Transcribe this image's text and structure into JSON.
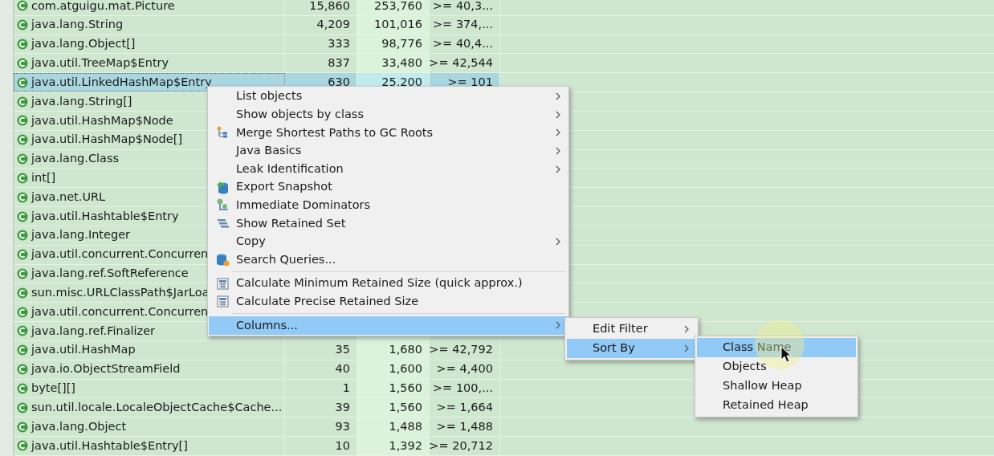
{
  "table": {
    "rows": [
      {
        "name": "com.atguigu.mat.Picture",
        "objects": "15,860",
        "shallow": "253,760",
        "retained": ">= 40,3...",
        "selected": false
      },
      {
        "name": "java.lang.String",
        "objects": "4,209",
        "shallow": "101,016",
        "retained": ">= 374,...",
        "selected": false
      },
      {
        "name": "java.lang.Object[]",
        "objects": "333",
        "shallow": "98,776",
        "retained": ">= 40,4...",
        "selected": false
      },
      {
        "name": "java.util.TreeMap$Entry",
        "objects": "837",
        "shallow": "33,480",
        "retained": ">= 42,544",
        "selected": false
      },
      {
        "name": "java.util.LinkedHashMap$Entry",
        "objects": "630",
        "shallow": "25,200",
        "retained": ">= 101",
        "selected": true
      },
      {
        "name": "java.lang.String[]",
        "selected": false
      },
      {
        "name": "java.util.HashMap$Node",
        "selected": false
      },
      {
        "name": "java.util.HashMap$Node[]",
        "selected": false
      },
      {
        "name": "java.lang.Class",
        "selected": false
      },
      {
        "name": "int[]",
        "selected": false
      },
      {
        "name": "java.net.URL",
        "selected": false
      },
      {
        "name": "java.util.Hashtable$Entry",
        "selected": false
      },
      {
        "name": "java.lang.Integer",
        "selected": false
      },
      {
        "name": "java.util.concurrent.Concurren",
        "selected": false
      },
      {
        "name": "java.lang.ref.SoftReference",
        "selected": false
      },
      {
        "name": "sun.misc.URLClassPath$JarLoa",
        "selected": false
      },
      {
        "name": "java.util.concurrent.Concurren",
        "selected": false
      },
      {
        "name": "java.lang.ref.Finalizer",
        "selected": false
      },
      {
        "name": "java.util.HashMap",
        "objects": "35",
        "shallow": "1,680",
        "retained": ">= 42,792",
        "selected": false
      },
      {
        "name": "java.io.ObjectStreamField",
        "objects": "40",
        "shallow": "1,600",
        "retained": ">= 4,400",
        "selected": false
      },
      {
        "name": "byte[][]",
        "objects": "1",
        "shallow": "1,560",
        "retained": ">= 100,...",
        "selected": false
      },
      {
        "name": "sun.util.locale.LocaleObjectCache$Cache...",
        "objects": "39",
        "shallow": "1,560",
        "retained": ">= 1,664",
        "selected": false
      },
      {
        "name": "java.lang.Object",
        "objects": "93",
        "shallow": "1,488",
        "retained": ">= 1,488",
        "selected": false
      },
      {
        "name": "java.util.Hashtable$Entry[]",
        "objects": "10",
        "shallow": "1,392",
        "retained": ">= 20,712",
        "selected": false
      }
    ]
  },
  "context_menu": {
    "items": [
      {
        "kind": "item",
        "label": "List objects",
        "submenu": true,
        "selected": false
      },
      {
        "kind": "item",
        "label": "Show objects by class",
        "submenu": true,
        "selected": false
      },
      {
        "kind": "item",
        "label": "Merge Shortest Paths to GC Roots",
        "submenu": true,
        "selected": false
      },
      {
        "kind": "item",
        "label": "Java Basics",
        "submenu": true,
        "selected": false
      },
      {
        "kind": "item",
        "label": "Leak Identification",
        "submenu": true,
        "selected": false
      },
      {
        "kind": "item",
        "label": "Export Snapshot",
        "submenu": false,
        "selected": false
      },
      {
        "kind": "item",
        "label": "Immediate Dominators",
        "submenu": false,
        "selected": false
      },
      {
        "kind": "item",
        "label": "Show Retained Set",
        "submenu": false,
        "selected": false
      },
      {
        "kind": "item",
        "label": "Copy",
        "submenu": true,
        "selected": false
      },
      {
        "kind": "item",
        "label": "Search Queries...",
        "submenu": false,
        "selected": false
      },
      {
        "kind": "separator"
      },
      {
        "kind": "item",
        "label": "Calculate Minimum Retained Size (quick approx.)",
        "submenu": false,
        "selected": false
      },
      {
        "kind": "item",
        "label": "Calculate Precise Retained Size",
        "submenu": false,
        "selected": false
      },
      {
        "kind": "separator"
      },
      {
        "kind": "item",
        "label": "Columns...",
        "submenu": true,
        "selected": true
      }
    ]
  },
  "columns_submenu": {
    "items": [
      {
        "label": "Edit Filter",
        "submenu": true,
        "selected": false
      },
      {
        "label": "Sort By",
        "submenu": true,
        "selected": true
      }
    ]
  },
  "sort_by_submenu": {
    "items": [
      {
        "label": "Class Name",
        "selected": true
      },
      {
        "label": "Objects",
        "selected": false
      },
      {
        "label": "Shallow Heap",
        "selected": false
      },
      {
        "label": "Retained Heap",
        "selected": false
      }
    ]
  }
}
